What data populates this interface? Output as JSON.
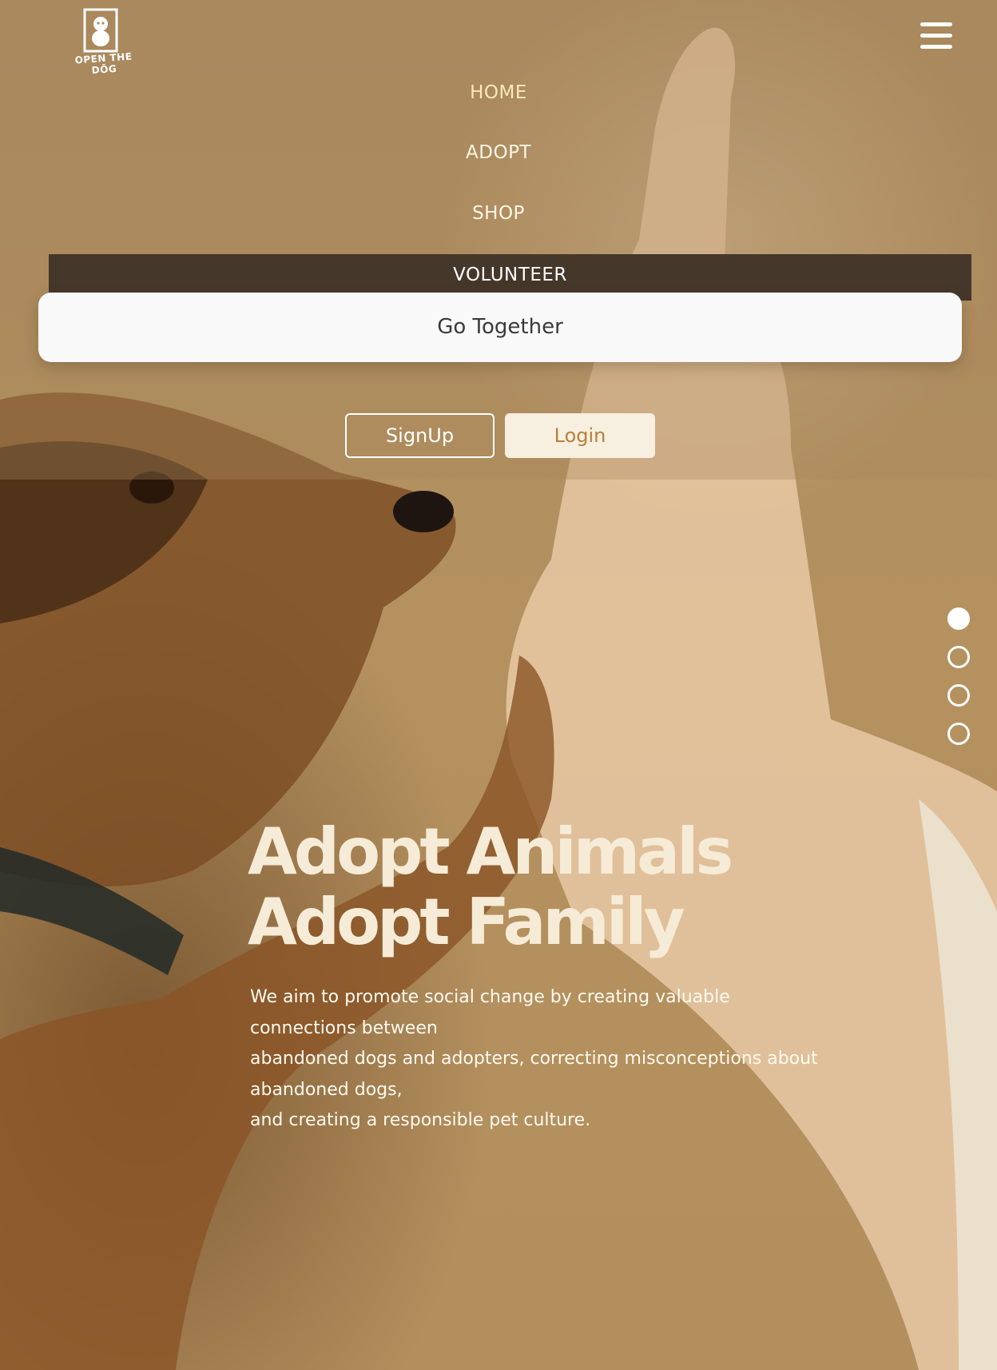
{
  "brand": {
    "logo_text": "OPEN THE DŌG"
  },
  "header": {
    "menu_icon": "hamburger-menu-icon"
  },
  "nav": {
    "items": [
      "HOME",
      "ADOPT",
      "SHOP",
      "VOLUNTEER"
    ],
    "active_item": "HOME",
    "volunteer_submenu": [
      "Go Together"
    ]
  },
  "auth": {
    "signup_label": "SignUp",
    "login_label": "Login"
  },
  "slider": {
    "dot_count": 4,
    "active_index": 0
  },
  "hero": {
    "title_line1": "Adopt Animals",
    "title_line2": "Adopt Family",
    "description_lines": [
      "We aim to promote social change by creating valuable connections between",
      "abandoned dogs and adopters, correcting misconceptions about abandoned dogs,",
      "and creating a responsible pet culture."
    ]
  },
  "colors": {
    "accent_nav": "#fbe9b5",
    "volunteer_bar": "#45372a",
    "login_bg": "#f7efdf",
    "login_text": "#b5803e",
    "hero_title": "#f6ebd6"
  }
}
